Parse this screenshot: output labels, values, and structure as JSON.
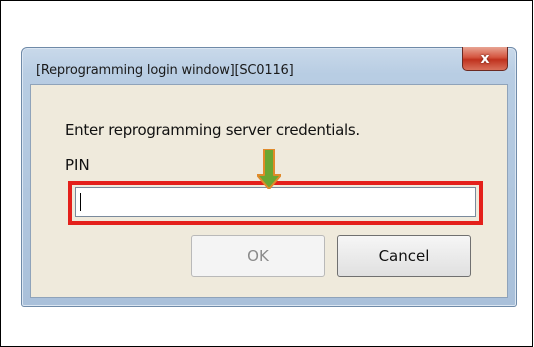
{
  "dialog": {
    "title": "[Reprogramming login window][SC0116]",
    "close_glyph": "x",
    "prompt": "Enter reprogramming server credentials.",
    "pin_label": "PIN",
    "pin_value": "",
    "ok_label": "OK",
    "cancel_label": "Cancel"
  },
  "annotations": {
    "highlight_color": "#e4201b",
    "arrow_color": "#6aa632",
    "arrow_outline_color": "#e08a2a"
  }
}
